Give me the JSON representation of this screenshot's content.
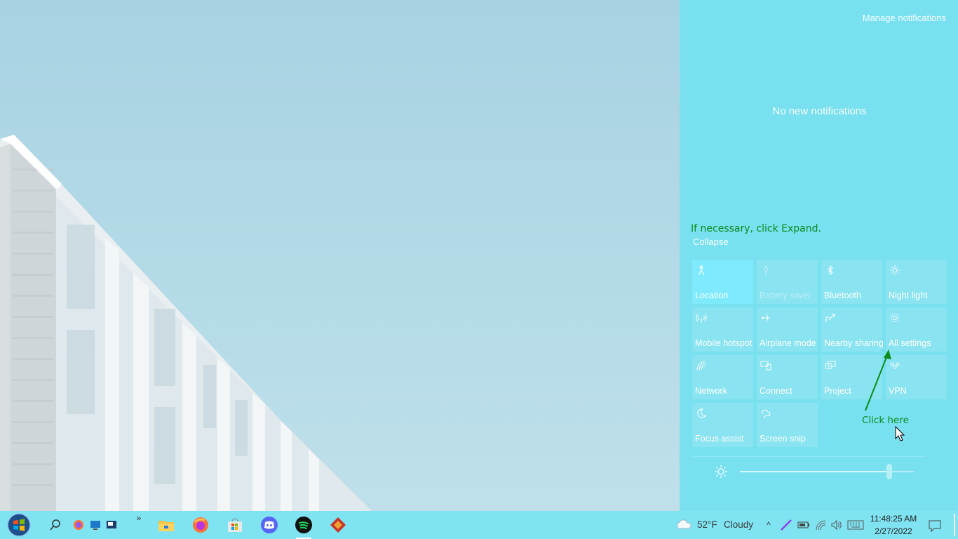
{
  "action_center": {
    "manage_notifications": "Manage notifications",
    "no_notifications": "No new notifications",
    "instruction": "If necessary, click Expand.",
    "collapse": "Collapse",
    "tiles": [
      {
        "label": "Location",
        "icon": "location-icon",
        "state": "on"
      },
      {
        "label": "Battery saver",
        "icon": "battery-saver-icon",
        "state": "disabled"
      },
      {
        "label": "Bluetooth",
        "icon": "bluetooth-icon",
        "state": "off"
      },
      {
        "label": "Night light",
        "icon": "night-light-icon",
        "state": "off"
      },
      {
        "label": "Mobile hotspot",
        "icon": "mobile-hotspot-icon",
        "state": "off"
      },
      {
        "label": "Airplane mode",
        "icon": "airplane-icon",
        "state": "off"
      },
      {
        "label": "Nearby sharing",
        "icon": "nearby-sharing-icon",
        "state": "off"
      },
      {
        "label": "All settings",
        "icon": "gear-icon",
        "state": "off"
      },
      {
        "label": "Network",
        "icon": "network-icon",
        "state": "off"
      },
      {
        "label": "Connect",
        "icon": "connect-icon",
        "state": "off"
      },
      {
        "label": "Project",
        "icon": "project-icon",
        "state": "off"
      },
      {
        "label": "VPN",
        "icon": "vpn-icon",
        "state": "off"
      },
      {
        "label": "Focus assist",
        "icon": "moon-icon",
        "state": "off"
      },
      {
        "label": "Screen snip",
        "icon": "screen-snip-icon",
        "state": "off"
      }
    ],
    "annotation": "Click here",
    "brightness_level": 0.86
  },
  "taskbar": {
    "weather_temp": "52°F",
    "weather_condition": "Cloudy",
    "time": "11:48:25 AM",
    "date": "2/27/2022"
  },
  "colors": {
    "accent": "#79e0ef",
    "annotation": "#0d8a1c"
  }
}
